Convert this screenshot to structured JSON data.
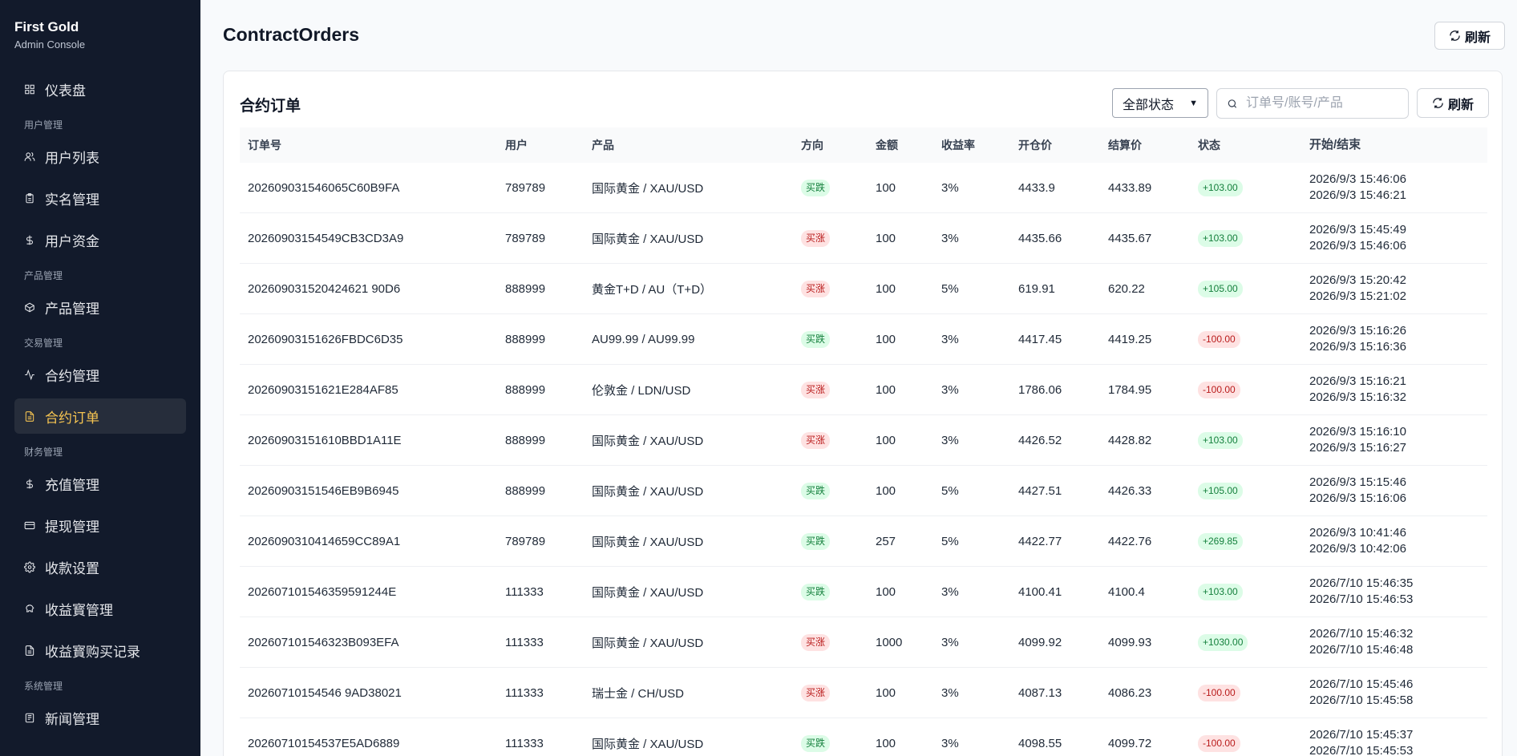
{
  "sidebar": {
    "brand_title": "First Gold",
    "brand_sub": "Admin Console",
    "items": [
      {
        "type": "item",
        "label": "仪表盘",
        "icon": "grid-icon"
      },
      {
        "type": "group",
        "label": "用户管理"
      },
      {
        "type": "item",
        "label": "用户列表",
        "icon": "users-icon"
      },
      {
        "type": "item",
        "label": "实名管理",
        "icon": "clipboard-icon"
      },
      {
        "type": "item",
        "label": "用户资金",
        "icon": "dollar-icon"
      },
      {
        "type": "group",
        "label": "产品管理"
      },
      {
        "type": "item",
        "label": "产品管理",
        "icon": "box-icon"
      },
      {
        "type": "group",
        "label": "交易管理"
      },
      {
        "type": "item",
        "label": "合约管理",
        "icon": "activity-icon"
      },
      {
        "type": "item",
        "label": "合约订单",
        "icon": "file-icon",
        "active": true
      },
      {
        "type": "group",
        "label": "财务管理"
      },
      {
        "type": "item",
        "label": "充值管理",
        "icon": "dollar-icon"
      },
      {
        "type": "item",
        "label": "提现管理",
        "icon": "credit-card-icon"
      },
      {
        "type": "item",
        "label": "收款设置",
        "icon": "gear-icon"
      },
      {
        "type": "item",
        "label": "收益寳管理",
        "icon": "piggy-bank-icon"
      },
      {
        "type": "item",
        "label": "收益寳购买记录",
        "icon": "file-icon"
      },
      {
        "type": "group",
        "label": "系统管理"
      },
      {
        "type": "item",
        "label": "新闻管理",
        "icon": "newspaper-icon"
      }
    ]
  },
  "header": {
    "title": "ContractOrders",
    "refresh_label": "刷新"
  },
  "card": {
    "title": "合约订单",
    "status_filter": "全部状态",
    "search_placeholder": "订单号/账号/产品",
    "refresh_label": "刷新"
  },
  "table": {
    "columns": [
      "订单号",
      "用户",
      "产品",
      "方向",
      "金额",
      "收益率",
      "开仓价",
      "结算价",
      "状态",
      "开始/结束"
    ],
    "rows": [
      {
        "order": "202609031546065C60B9FA",
        "user": "789789",
        "product": "国际黄金 / XAU/USD",
        "direction": "买跌",
        "dir_type": "down",
        "amount": "100",
        "rate": "3%",
        "open": "4433.9",
        "settle": "4433.89",
        "status": "+103.00",
        "status_type": "pos",
        "start": "2026/9/3 15:46:06",
        "end": "2026/9/3 15:46:21"
      },
      {
        "order": "20260903154549CB3CD3A9",
        "user": "789789",
        "product": "国际黄金 / XAU/USD",
        "direction": "买涨",
        "dir_type": "up",
        "amount": "100",
        "rate": "3%",
        "open": "4435.66",
        "settle": "4435.67",
        "status": "+103.00",
        "status_type": "pos",
        "start": "2026/9/3 15:45:49",
        "end": "2026/9/3 15:46:06"
      },
      {
        "order": "202609031520424621 90D6",
        "user": "888999",
        "product": "黄金T+D / AU（T+D）",
        "direction": "买涨",
        "dir_type": "up",
        "amount": "100",
        "rate": "5%",
        "open": "619.91",
        "settle": "620.22",
        "status": "+105.00",
        "status_type": "pos",
        "start": "2026/9/3 15:20:42",
        "end": "2026/9/3 15:21:02"
      },
      {
        "order": "20260903151626FBDC6D35",
        "user": "888999",
        "product": "AU99.99 / AU99.99",
        "direction": "买跌",
        "dir_type": "down",
        "amount": "100",
        "rate": "3%",
        "open": "4417.45",
        "settle": "4419.25",
        "status": "-100.00",
        "status_type": "neg",
        "start": "2026/9/3 15:16:26",
        "end": "2026/9/3 15:16:36"
      },
      {
        "order": "20260903151621E284AF85",
        "user": "888999",
        "product": "伦敦金 / LDN/USD",
        "direction": "买涨",
        "dir_type": "up",
        "amount": "100",
        "rate": "3%",
        "open": "1786.06",
        "settle": "1784.95",
        "status": "-100.00",
        "status_type": "neg",
        "start": "2026/9/3 15:16:21",
        "end": "2026/9/3 15:16:32"
      },
      {
        "order": "20260903151610BBD1A11E",
        "user": "888999",
        "product": "国际黄金 / XAU/USD",
        "direction": "买涨",
        "dir_type": "up",
        "amount": "100",
        "rate": "3%",
        "open": "4426.52",
        "settle": "4428.82",
        "status": "+103.00",
        "status_type": "pos",
        "start": "2026/9/3 15:16:10",
        "end": "2026/9/3 15:16:27"
      },
      {
        "order": "20260903151546EB9B6945",
        "user": "888999",
        "product": "国际黄金 / XAU/USD",
        "direction": "买跌",
        "dir_type": "down",
        "amount": "100",
        "rate": "5%",
        "open": "4427.51",
        "settle": "4426.33",
        "status": "+105.00",
        "status_type": "pos",
        "start": "2026/9/3 15:15:46",
        "end": "2026/9/3 15:16:06"
      },
      {
        "order": "2026090310414659CC89A1",
        "user": "789789",
        "product": "国际黄金 / XAU/USD",
        "direction": "买跌",
        "dir_type": "down",
        "amount": "257",
        "rate": "5%",
        "open": "4422.77",
        "settle": "4422.76",
        "status": "+269.85",
        "status_type": "pos",
        "start": "2026/9/3 10:41:46",
        "end": "2026/9/3 10:42:06"
      },
      {
        "order": "202607101546359591244E",
        "user": "111333",
        "product": "国际黄金 / XAU/USD",
        "direction": "买跌",
        "dir_type": "down",
        "amount": "100",
        "rate": "3%",
        "open": "4100.41",
        "settle": "4100.4",
        "status": "+103.00",
        "status_type": "pos",
        "start": "2026/7/10 15:46:35",
        "end": "2026/7/10 15:46:53"
      },
      {
        "order": "202607101546323B093EFA",
        "user": "111333",
        "product": "国际黄金 / XAU/USD",
        "direction": "买涨",
        "dir_type": "up",
        "amount": "1000",
        "rate": "3%",
        "open": "4099.92",
        "settle": "4099.93",
        "status": "+1030.00",
        "status_type": "pos",
        "start": "2026/7/10 15:46:32",
        "end": "2026/7/10 15:46:48"
      },
      {
        "order": "20260710154546 9AD38021",
        "user": "111333",
        "product": "瑞士金 / CH/USD",
        "direction": "买涨",
        "dir_type": "up",
        "amount": "100",
        "rate": "3%",
        "open": "4087.13",
        "settle": "4086.23",
        "status": "-100.00",
        "status_type": "neg",
        "start": "2026/7/10 15:45:46",
        "end": "2026/7/10 15:45:58"
      },
      {
        "order": "20260710154537E5AD6889",
        "user": "111333",
        "product": "国际黄金 / XAU/USD",
        "direction": "买跌",
        "dir_type": "down",
        "amount": "100",
        "rate": "3%",
        "open": "4098.55",
        "settle": "4099.72",
        "status": "-100.00",
        "status_type": "neg",
        "start": "2026/7/10 15:45:37",
        "end": "2026/7/10 15:45:53"
      }
    ]
  }
}
